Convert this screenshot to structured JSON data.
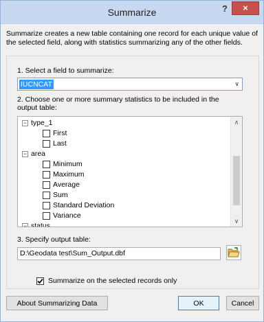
{
  "window": {
    "title": "Summarize",
    "help": "?",
    "close": "×"
  },
  "description": "Summarize creates a new table containing one record for each unique value of the selected field, along with statistics summarizing any of the other fields.",
  "step1": {
    "label": "1.  Select a field to summarize:",
    "value": "IUCNCAT"
  },
  "step2": {
    "label": "2.  Choose one or more summary statistics to be included in the output table:",
    "groups": [
      {
        "name": "type_1",
        "items": [
          "First",
          "Last"
        ]
      },
      {
        "name": "area",
        "items": [
          "Minimum",
          "Maximum",
          "Average",
          "Sum",
          "Standard Deviation",
          "Variance"
        ]
      },
      {
        "name": "status",
        "items": []
      }
    ]
  },
  "step3": {
    "label": "3.  Specify output table:",
    "value": "D:\\Geodata test\\Sum_Output.dbf"
  },
  "selected_only": {
    "label": "Summarize on the selected records only",
    "checked": true
  },
  "buttons": {
    "about": "About Summarizing Data",
    "ok": "OK",
    "cancel": "Cancel"
  }
}
